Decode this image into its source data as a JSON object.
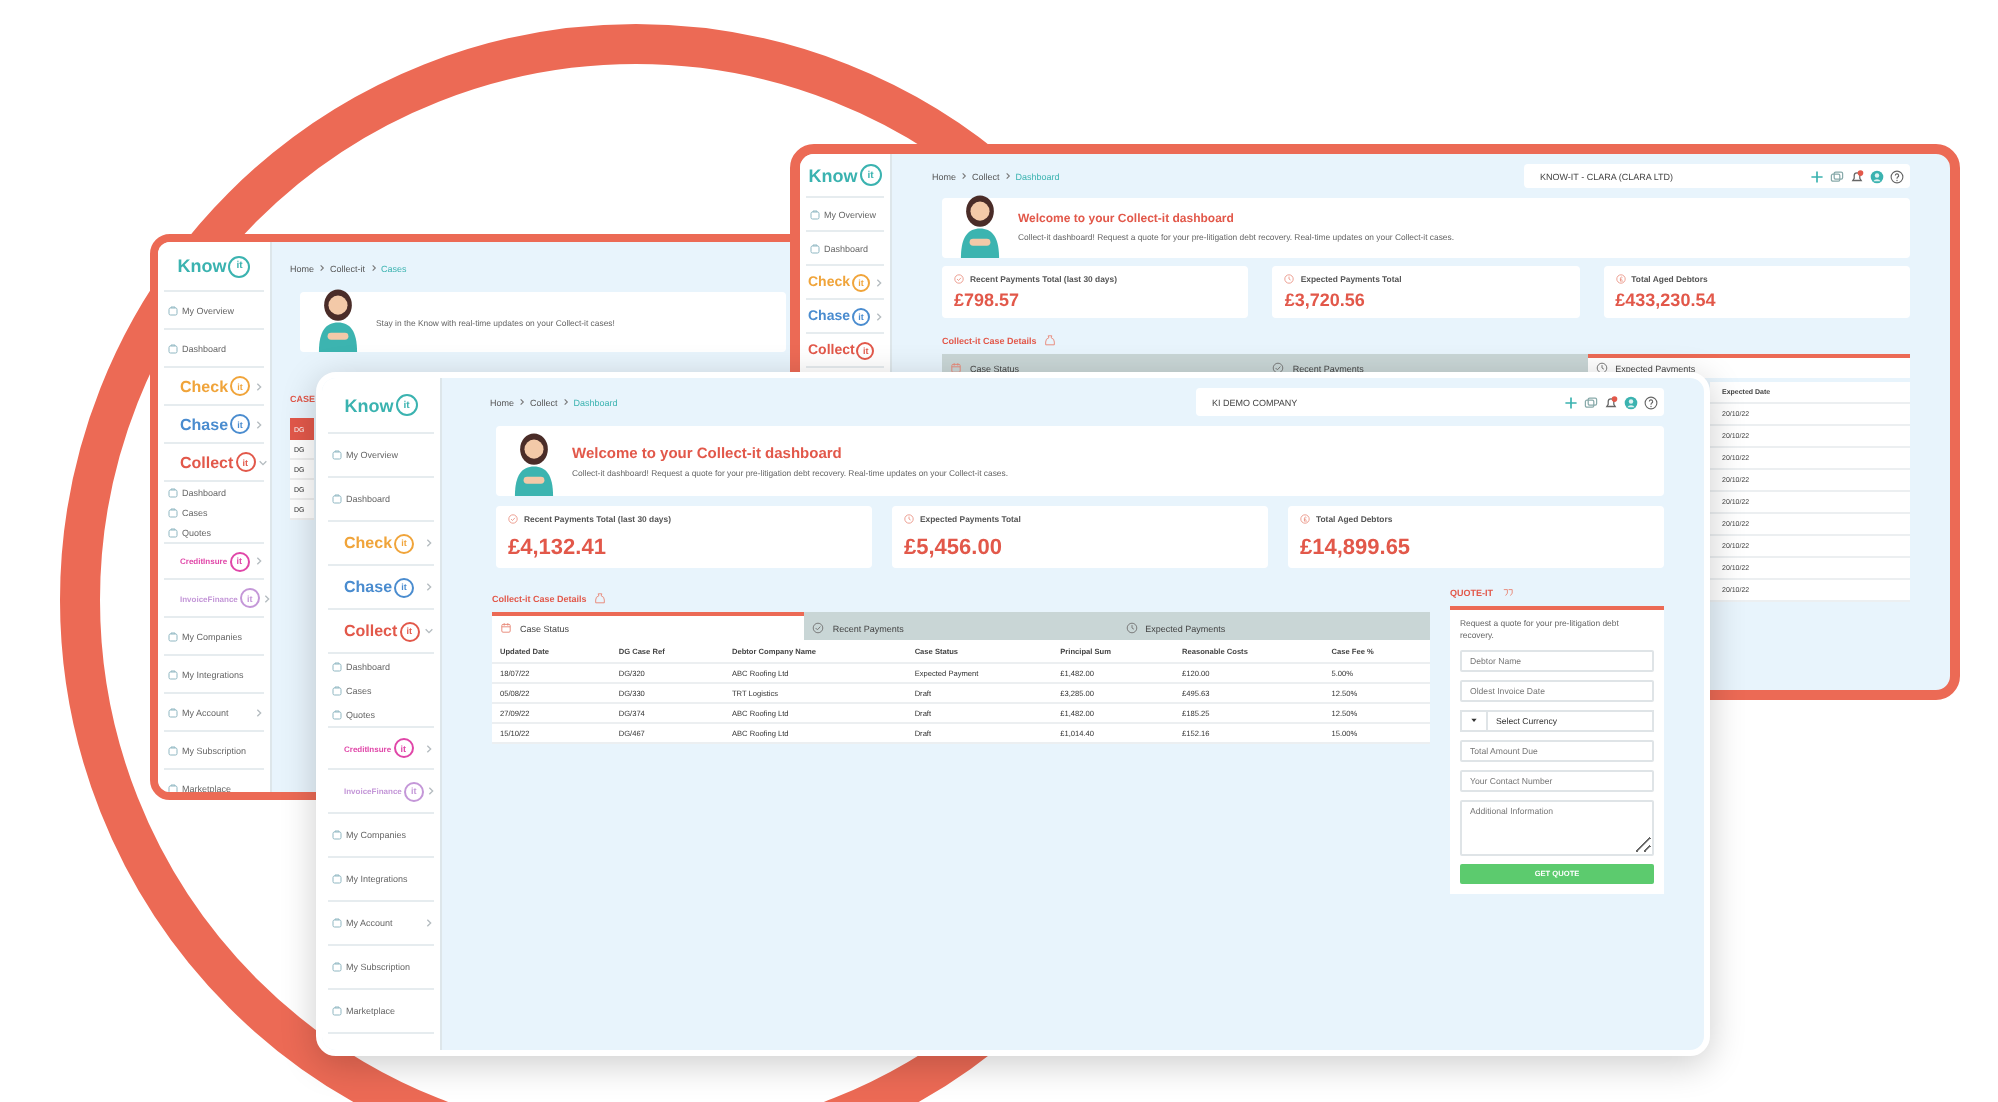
{
  "windows": [
    {
      "kind": "back_left",
      "logo": {
        "word": "Know",
        "mark": "it"
      },
      "sidebar": [
        {
          "kind": "link",
          "label": "My Overview"
        },
        {
          "kind": "link",
          "label": "Dashboard"
        },
        {
          "kind": "brand",
          "label": "Check",
          "mark": "it",
          "color": "#f0a43a",
          "expanded": false
        },
        {
          "kind": "brand",
          "label": "Chase",
          "mark": "it",
          "color": "#4a8ccf",
          "expanded": false
        },
        {
          "kind": "brand",
          "label": "Collect",
          "mark": "it",
          "color": "#e2584a",
          "expanded": true
        },
        {
          "kind": "sub",
          "label": "Dashboard"
        },
        {
          "kind": "sub",
          "label": "Cases"
        },
        {
          "kind": "sub",
          "label": "Quotes"
        },
        {
          "kind": "minibrand",
          "label": "CreditInsure",
          "mark": "it",
          "color": "#e046a8",
          "expanded": false
        },
        {
          "kind": "minibrand",
          "label": "InvoiceFinance",
          "mark": "it",
          "color": "#c497d8",
          "expanded": false
        },
        {
          "kind": "link",
          "label": "My Companies"
        },
        {
          "kind": "link",
          "label": "My Integrations"
        },
        {
          "kind": "link",
          "label": "My Account",
          "expanded": false
        },
        {
          "kind": "link",
          "label": "My Subscription"
        },
        {
          "kind": "link",
          "label": "Marketplace"
        }
      ],
      "breadcrumb": [
        {
          "label": "Home",
          "current": false
        },
        {
          "label": "Collect-it",
          "current": false
        },
        {
          "label": "Cases",
          "current": true
        }
      ],
      "welcome": {
        "text": "Stay in the Know with real-time updates on your Collect-it cases!"
      },
      "case_strip": {
        "title": "CASE",
        "header": "DG",
        "rows": [
          "DG",
          "DG",
          "DG",
          "DG"
        ]
      }
    },
    {
      "kind": "back_right",
      "logo": {
        "word": "Know",
        "mark": "it"
      },
      "sidebar": [
        {
          "kind": "link",
          "label": "My Overview"
        },
        {
          "kind": "link",
          "label": "Dashboard"
        },
        {
          "kind": "brand",
          "label": "Check",
          "mark": "it",
          "color": "#f0a43a",
          "expanded": false
        },
        {
          "kind": "brand",
          "label": "Chase",
          "mark": "it",
          "color": "#4a8ccf",
          "expanded": false
        },
        {
          "kind": "brand",
          "label": "Collect",
          "mark": "it",
          "color": "#e2584a"
        }
      ],
      "breadcrumb": [
        {
          "label": "Home",
          "current": false
        },
        {
          "label": "Collect",
          "current": false
        },
        {
          "label": "Dashboard",
          "current": true
        }
      ],
      "company": "KNOW-IT - CLARA (CLARA LTD)",
      "welcome": {
        "title": "Welcome to your Collect-it dashboard",
        "text": "Collect-it dashboard! Request a quote for your pre-litigation debt recovery. Real-time updates on your Collect-it cases."
      },
      "stats": [
        {
          "label": "Recent Payments Total (last 30 days)",
          "value": "£798.57"
        },
        {
          "label": "Expected Payments Total",
          "value": "£3,720.56"
        },
        {
          "label": "Total Aged Debtors",
          "value": "£433,230.54"
        }
      ],
      "section_title": "Collect-it Case Details",
      "tabs": [
        {
          "label": "Case Status",
          "selected": false
        },
        {
          "label": "Recent Payments",
          "selected": false
        },
        {
          "label": "Expected Payments",
          "selected": true
        }
      ],
      "side_table": {
        "column": "Expected Date",
        "rows": [
          "20/10/22",
          "20/10/22",
          "20/10/22",
          "20/10/22",
          "20/10/22",
          "20/10/22",
          "20/10/22",
          "20/10/22",
          "20/10/22"
        ]
      }
    },
    {
      "kind": "front",
      "logo": {
        "word": "Know",
        "mark": "it"
      },
      "sidebar": [
        {
          "kind": "link",
          "label": "My Overview"
        },
        {
          "kind": "link",
          "label": "Dashboard"
        },
        {
          "kind": "brand",
          "label": "Check",
          "mark": "it",
          "color": "#f0a43a",
          "expanded": false
        },
        {
          "kind": "brand",
          "label": "Chase",
          "mark": "it",
          "color": "#4a8ccf",
          "expanded": false
        },
        {
          "kind": "brand",
          "label": "Collect",
          "mark": "it",
          "color": "#e2584a",
          "expanded": true
        },
        {
          "kind": "sub",
          "label": "Dashboard"
        },
        {
          "kind": "sub",
          "label": "Cases"
        },
        {
          "kind": "sub",
          "label": "Quotes"
        },
        {
          "kind": "minibrand",
          "label": "CreditInsure",
          "mark": "it",
          "color": "#e046a8",
          "expanded": false
        },
        {
          "kind": "minibrand",
          "label": "InvoiceFinance",
          "mark": "it",
          "color": "#c497d8",
          "expanded": false
        },
        {
          "kind": "link",
          "label": "My Companies"
        },
        {
          "kind": "link",
          "label": "My Integrations"
        },
        {
          "kind": "link",
          "label": "My Account",
          "expanded": false
        },
        {
          "kind": "link",
          "label": "My Subscription"
        },
        {
          "kind": "link",
          "label": "Marketplace"
        }
      ],
      "breadcrumb": [
        {
          "label": "Home",
          "current": false
        },
        {
          "label": "Collect",
          "current": false
        },
        {
          "label": "Dashboard",
          "current": true
        }
      ],
      "company": "KI DEMO COMPANY",
      "welcome": {
        "title": "Welcome to your Collect-it dashboard",
        "text": "Collect-it dashboard! Request a quote for your pre-litigation debt recovery. Real-time updates on your Collect-it cases."
      },
      "stats": [
        {
          "label": "Recent Payments Total (last 30 days)",
          "value": "£4,132.41"
        },
        {
          "label": "Expected Payments Total",
          "value": "£5,456.00"
        },
        {
          "label": "Total Aged Debtors",
          "value": "£14,899.65"
        }
      ],
      "section_title": "Collect-it Case Details",
      "tabs": [
        {
          "label": "Case Status",
          "selected": true
        },
        {
          "label": "Recent Payments",
          "selected": false
        },
        {
          "label": "Expected Payments",
          "selected": false
        }
      ],
      "table": {
        "columns": [
          "Updated Date",
          "DG Case Ref",
          "Debtor Company Name",
          "Case Status",
          "Principal Sum",
          "Reasonable Costs",
          "Case Fee %"
        ],
        "rows": [
          [
            "18/07/22",
            "DG/320",
            "ABC Roofing Ltd",
            "Expected Payment",
            "£1,482.00",
            "£120.00",
            "5.00%"
          ],
          [
            "05/08/22",
            "DG/330",
            "TRT Logistics",
            "Draft",
            "£3,285.00",
            "£495.63",
            "12.50%"
          ],
          [
            "27/09/22",
            "DG/374",
            "ABC Roofing Ltd",
            "Draft",
            "£1,482.00",
            "£185.25",
            "12.50%"
          ],
          [
            "15/10/22",
            "DG/467",
            "ABC Roofing Ltd",
            "Draft",
            "£1,014.40",
            "£152.16",
            "15.00%"
          ]
        ]
      },
      "quote": {
        "title": "QUOTE-IT",
        "description": "Request a quote for your pre-litigation debt recovery.",
        "fields": [
          {
            "kind": "input",
            "placeholder": "Debtor Name"
          },
          {
            "kind": "input",
            "placeholder": "Oldest Invoice Date"
          },
          {
            "kind": "select",
            "value": "Select Currency"
          },
          {
            "kind": "input",
            "placeholder": "Total Amount Due"
          },
          {
            "kind": "input",
            "placeholder": "Your Contact Number"
          },
          {
            "kind": "textarea",
            "placeholder": "Additional Information"
          }
        ],
        "button": "GET QUOTE"
      }
    }
  ]
}
